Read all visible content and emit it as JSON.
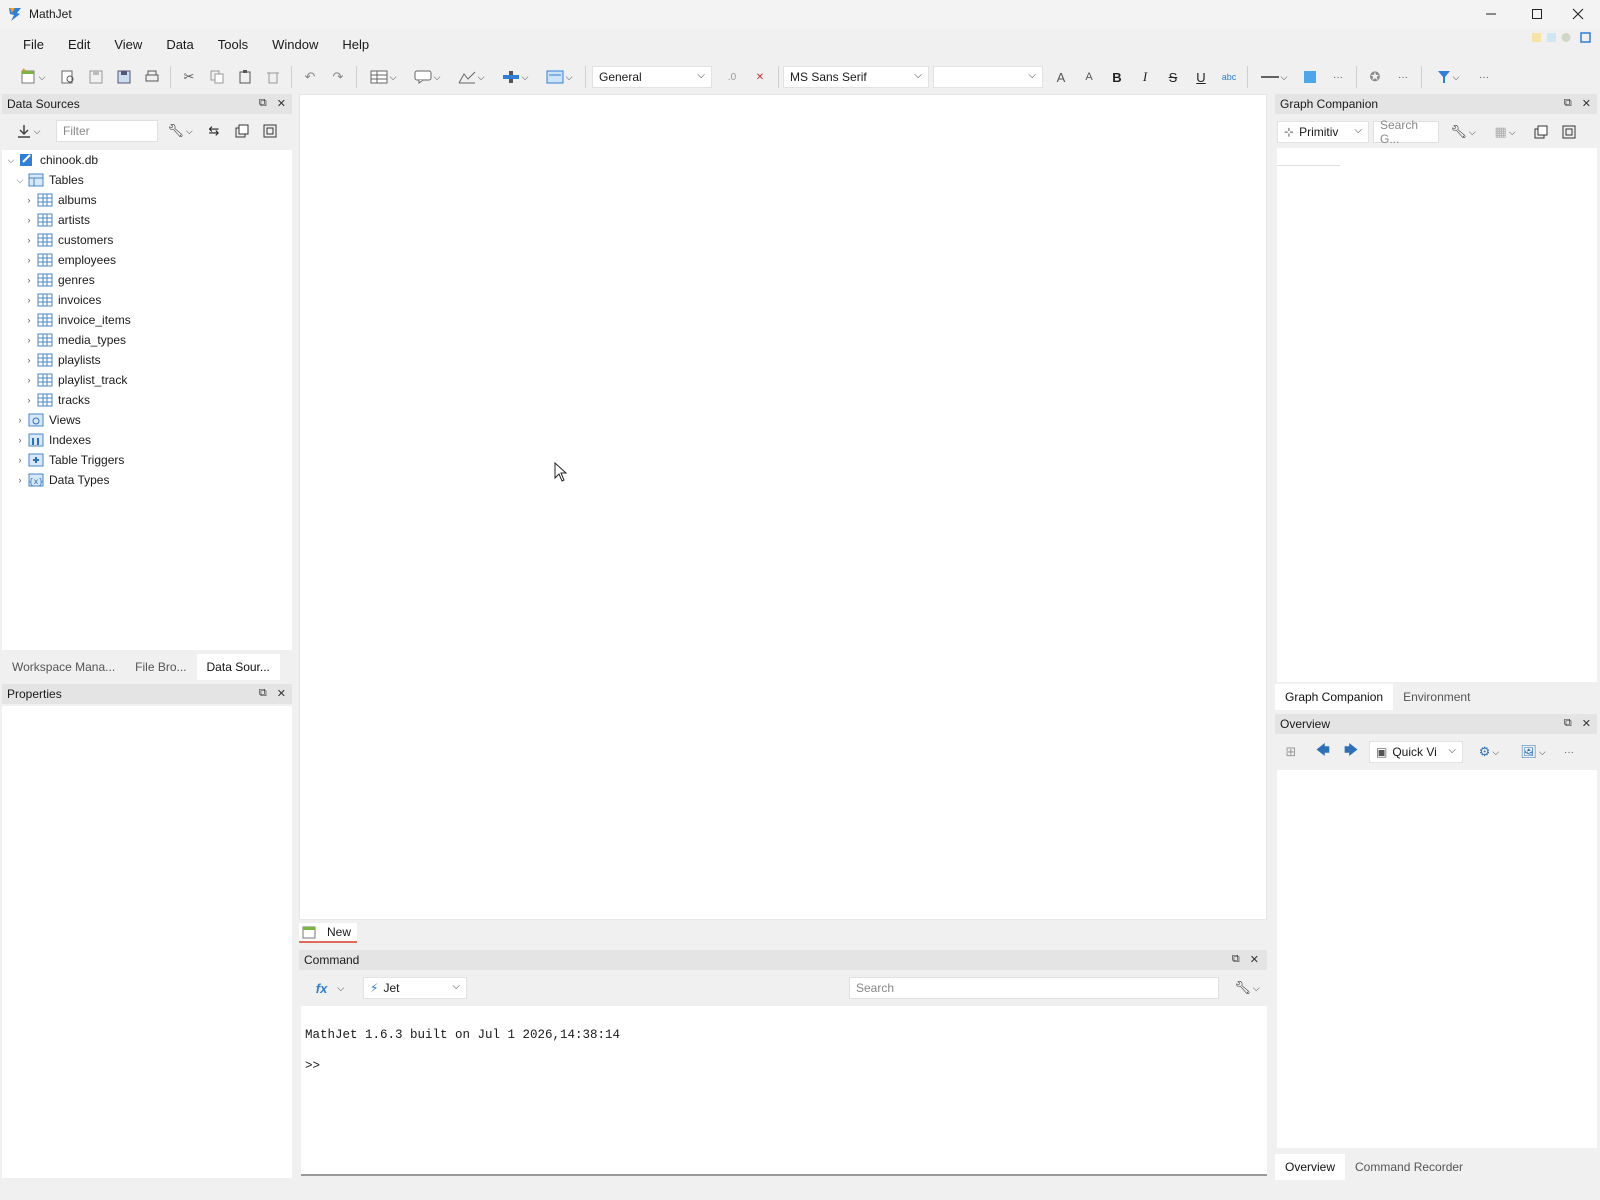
{
  "window": {
    "title": "MathJet"
  },
  "menu": [
    "File",
    "Edit",
    "View",
    "Data",
    "Tools",
    "Window",
    "Help"
  ],
  "toolbar": {
    "format_value": "General",
    "font_value": "MS Sans Serif",
    "size_value": ""
  },
  "data_sources": {
    "title": "Data Sources",
    "filter_placeholder": "Filter",
    "tree": {
      "root": "chinook.db",
      "tables_label": "Tables",
      "tables": [
        "albums",
        "artists",
        "customers",
        "employees",
        "genres",
        "invoices",
        "invoice_items",
        "media_types",
        "playlists",
        "playlist_track",
        "tracks"
      ],
      "groups": [
        "Views",
        "Indexes",
        "Table Triggers",
        "Data Types"
      ]
    },
    "tabs": [
      "Workspace Mana...",
      "File Bro...",
      "Data Sour..."
    ]
  },
  "properties": {
    "title": "Properties"
  },
  "graph_companion": {
    "title": "Graph Companion",
    "primitive_value": "Primitiv",
    "search_placeholder": "Search G...",
    "tabs": [
      "Graph Companion",
      "Environment"
    ]
  },
  "overview": {
    "title": "Overview",
    "quickview_value": "Quick Vi",
    "tabs": [
      "Overview",
      "Command Recorder"
    ]
  },
  "workbook": {
    "new_tab_label": "New"
  },
  "command": {
    "title": "Command",
    "engine_value": "Jet",
    "search_placeholder": "Search",
    "output_line": "MathJet 1.6.3 built on Jul  1 2026,14:38:14",
    "prompt": ">>"
  },
  "colors": {
    "accent": "#2f7fd6",
    "panel_header": "#e4e4e4",
    "tab_underline": "#e06a5a"
  }
}
